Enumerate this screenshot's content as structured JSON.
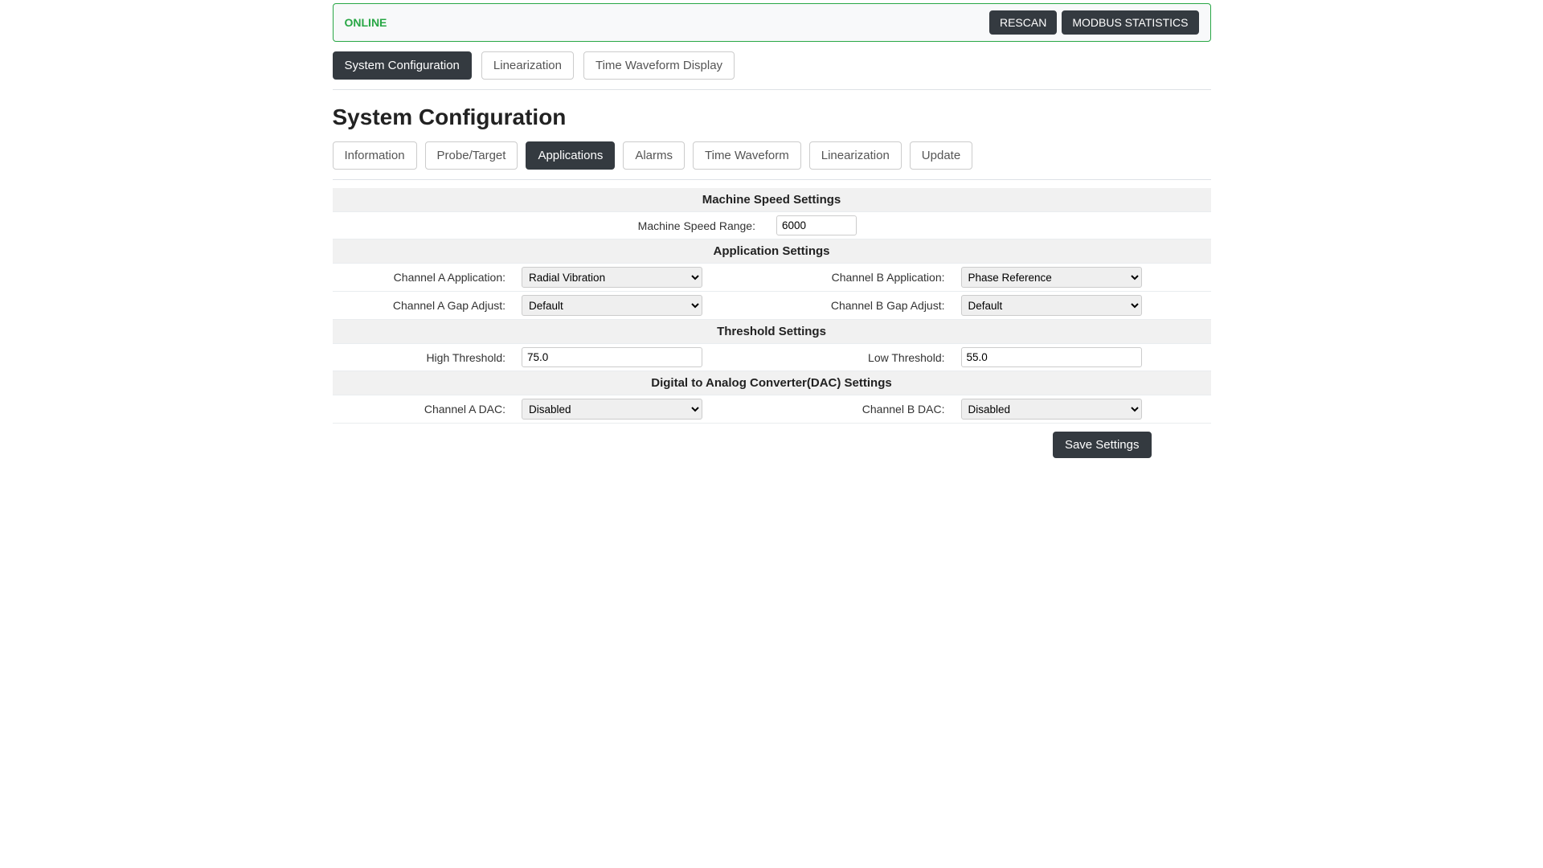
{
  "status": {
    "label": "ONLINE",
    "rescan": "RESCAN",
    "modbus": "MODBUS STATISTICS"
  },
  "topTabs": {
    "systemConfig": "System Configuration",
    "linearization": "Linearization",
    "timeWaveform": "Time Waveform Display"
  },
  "pageTitle": "System Configuration",
  "subTabs": {
    "information": "Information",
    "probeTarget": "Probe/Target",
    "applications": "Applications",
    "alarms": "Alarms",
    "timeWaveform": "Time Waveform",
    "linearization": "Linearization",
    "update": "Update"
  },
  "sections": {
    "machineSpeed": {
      "header": "Machine Speed Settings",
      "rangeLabel": "Machine Speed Range:",
      "rangeValue": "6000"
    },
    "application": {
      "header": "Application Settings",
      "chAAppLabel": "Channel A Application:",
      "chAAppValue": "Radial Vibration",
      "chBAppLabel": "Channel B Application:",
      "chBAppValue": "Phase Reference",
      "chAGapLabel": "Channel A Gap Adjust:",
      "chAGapValue": "Default",
      "chBGapLabel": "Channel B Gap Adjust:",
      "chBGapValue": "Default"
    },
    "threshold": {
      "header": "Threshold Settings",
      "highLabel": "High Threshold:",
      "highValue": "75.0",
      "lowLabel": "Low Threshold:",
      "lowValue": "55.0"
    },
    "dac": {
      "header": "Digital to Analog Converter(DAC) Settings",
      "chADacLabel": "Channel A DAC:",
      "chADacValue": "Disabled",
      "chBDacLabel": "Channel B DAC:",
      "chBDacValue": "Disabled"
    }
  },
  "saveButton": "Save Settings"
}
